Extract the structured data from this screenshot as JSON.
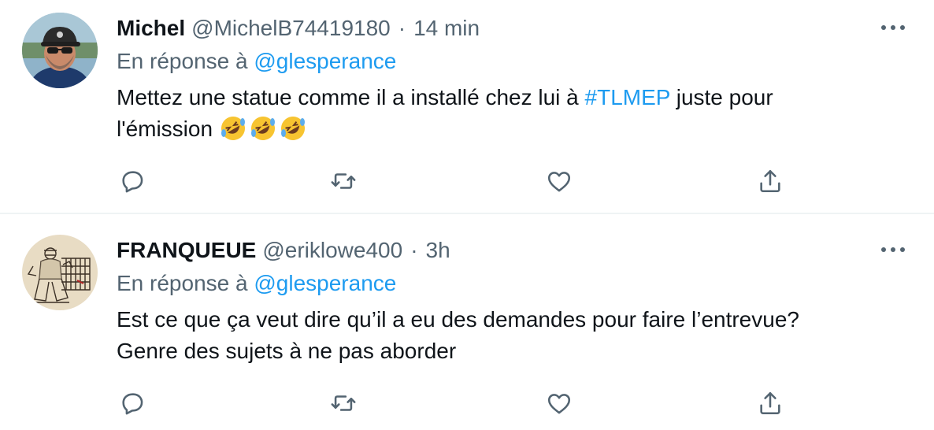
{
  "tweets": [
    {
      "name": "Michel",
      "handle": "@MichelB74419180",
      "separator": "·",
      "time": "14 min",
      "reply_prefix": "En réponse à",
      "reply_mention": "@glesperance",
      "text_before_hashtag": "Mettez une statue comme il a installé chez lui à ",
      "hashtag": "#TLMEP",
      "text_after_hashtag": " juste pour",
      "text_line2": "l'émission ",
      "emojis": [
        "rolling-on-floor-laughing",
        "rolling-on-floor-laughing",
        "rolling-on-floor-laughing"
      ],
      "avatar": "man-with-cap-and-sunglasses"
    },
    {
      "name": "FRANQUEUE",
      "handle": "@eriklowe400",
      "separator": "·",
      "time": "3h",
      "reply_prefix": "En réponse à",
      "reply_mention": "@glesperance",
      "text_line1": "Est ce que ça veut dire qu’il a eu des demandes pour faire l’entrevue?",
      "text_line2": "Genre des sujets à ne pas aborder",
      "avatar": "hockey-goalie-sketch"
    }
  ],
  "icons": {
    "more": "more-horizontal-icon",
    "reply": "reply-icon",
    "retweet": "retweet-icon",
    "like": "heart-icon",
    "share": "share-icon"
  },
  "colors": {
    "link": "#1d9bf0",
    "secondary_text": "#536471",
    "primary_text": "#0f1419",
    "divider": "#eff3f4"
  }
}
